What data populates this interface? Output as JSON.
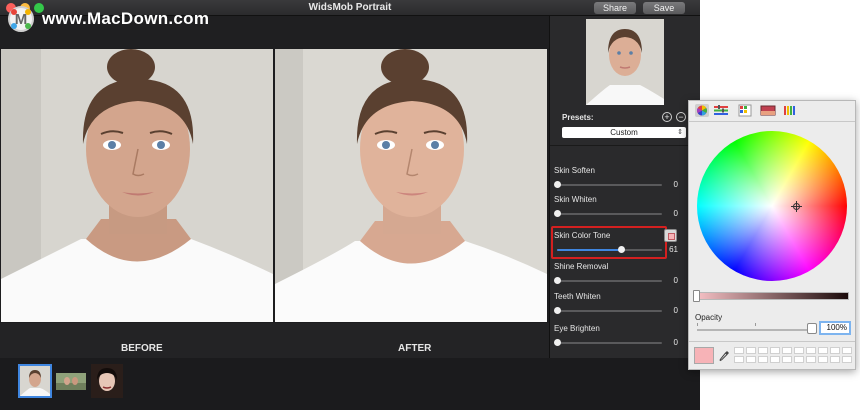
{
  "watermark": {
    "logo_letter": "M",
    "text": "www.MacDown.com"
  },
  "window": {
    "title": "WidsMob Portrait",
    "share_label": "Share",
    "save_label": "Save"
  },
  "captions": {
    "before": "BEFORE",
    "after": "AFTER"
  },
  "presets": {
    "label": "Presets:",
    "add_icon": "plus-circle-icon",
    "remove_icon": "minus-circle-icon",
    "selected": "Custom"
  },
  "adjustments": [
    {
      "label": "Skin Soften",
      "value": 0
    },
    {
      "label": "Skin Whiten",
      "value": 0
    },
    {
      "label": "Skin Color Tone",
      "value": 61,
      "highlighted": true
    },
    {
      "label": "Shine Removal",
      "value": 0
    },
    {
      "label": "Teeth Whiten",
      "value": 0
    },
    {
      "label": "Eye Brighten",
      "value": 0
    }
  ],
  "color_picker": {
    "tabs": [
      "color-wheel-icon",
      "color-sliders-icon",
      "color-palettes-icon",
      "image-palettes-icon",
      "pencils-icon"
    ],
    "opacity_label": "Opacity",
    "opacity_value": "100%",
    "opacity_fraction": 1.0,
    "brightness_fraction": 0.0,
    "current_color": "#f7b3b7",
    "swatch_slots": 20
  },
  "filmstrip": {
    "thumbnails": 3,
    "selected_index": 0
  },
  "colors": {
    "accent": "#3f86e0",
    "highlight_border": "#d42020",
    "window_bg": "#1d1d1f"
  }
}
